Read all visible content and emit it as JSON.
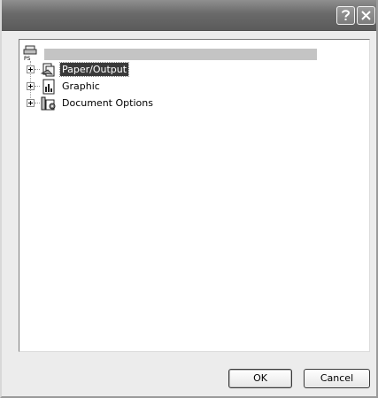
{
  "titlebar": {
    "help_icon": "help-icon",
    "close_icon": "close-icon"
  },
  "tree": {
    "root": {
      "icon": "printer-ps-icon",
      "label": ""
    },
    "items": [
      {
        "label": "Paper/Output",
        "icon": "paper-output-icon",
        "selected": true
      },
      {
        "label": "Graphic",
        "icon": "graphic-icon",
        "selected": false
      },
      {
        "label": "Document Options",
        "icon": "document-options-icon",
        "selected": false
      }
    ]
  },
  "buttons": {
    "ok_label": "OK",
    "cancel_label": "Cancel"
  },
  "colors": {
    "titlebar": "#5b5b5b",
    "selection": "#3a3a3a",
    "dialog_bg": "#ececec"
  }
}
